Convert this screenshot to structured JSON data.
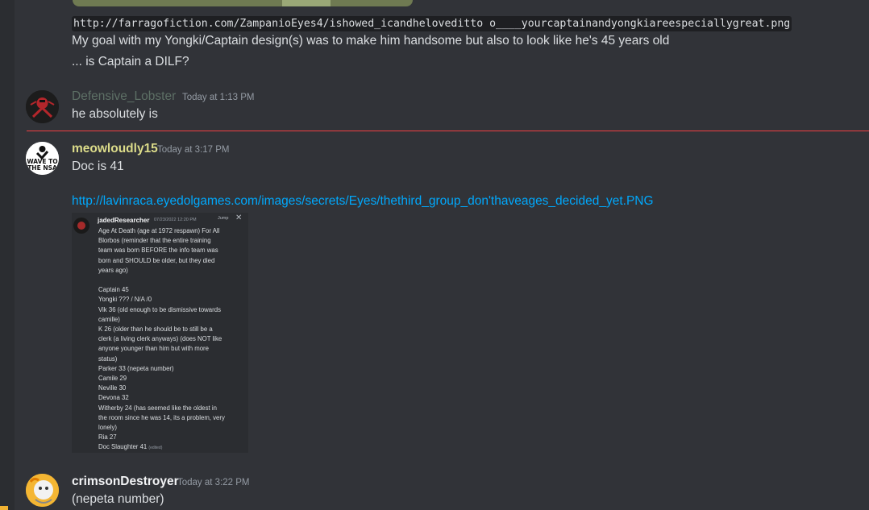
{
  "top_message": {
    "code_url": "http://farragofiction.com/ZampanioEyes4/ishowed_icandheloveditto o____yourcaptainandyongkiareespeciallygreat.png",
    "line1": "My goal with my Yongki/Captain design(s) was to make him handsome but also to look like he's 45 years old",
    "line2": "... is Captain a DILF?"
  },
  "messages": [
    {
      "username": "Defensive_Lobster",
      "timestamp": "Today at 1:13 PM",
      "text": "he absolutely is",
      "username_color": "#5d6f65"
    },
    {
      "username": "meowloudly15",
      "timestamp": "Today at 3:17 PM",
      "text": "Doc is 41",
      "link": "http://lavinraca.eyedolgames.com/images/secrets/Eyes/thethird_group_don'thaveages_decided_yet.PNG",
      "username_color": "#dcdc8a",
      "avatar_text": [
        "WAVE TO",
        "THE NSA"
      ]
    },
    {
      "username": "crimsonDestroyer",
      "timestamp": "Today at 3:22 PM",
      "text": "(nepeta number)",
      "username_color": "#f2f3f5"
    }
  ],
  "embed": {
    "username": "jadedResearcher",
    "timestamp": "07/23/2022 12:20 PM",
    "jump": "Jump",
    "close": "✕",
    "lines": [
      "Age At Death (age at 1972 respawn) For All",
      "Blorbos (reminder that the entire training",
      "team was born BEFORE the info team was",
      "born and SHOULD be older, but they died",
      "years ago)",
      "",
      "Captain 45",
      "Yongki ??? / N/A  /0",
      "Vik 36 (old enough to be dismissive towards",
      "camille)",
      "K 26  (older than he should be to still be a",
      "clerk (a living clerk anyways) (does NOT like",
      "anyone younger than him but with more",
      "status)",
      "Parker 33 (nepeta number)",
      "Camile 29",
      "Neville 30",
      "Devona 32",
      "Witherby 24  (has seemed like the oldest in",
      "the room since he was 14, its a problem, very",
      "lonely)",
      "Ria  27"
    ],
    "last_line": "Doc Slaughter 41",
    "edited": "(edited)"
  }
}
